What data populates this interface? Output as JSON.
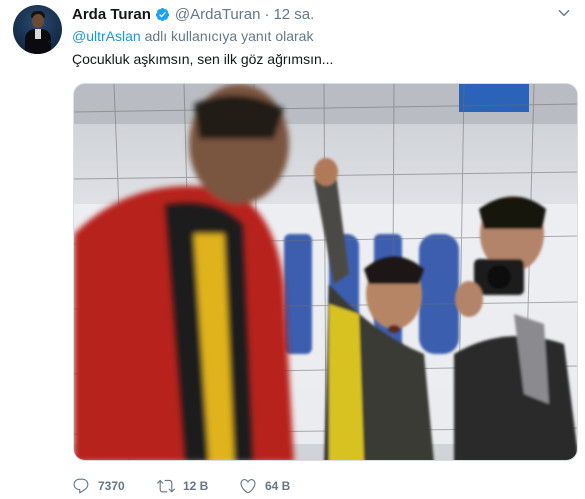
{
  "tweet": {
    "author_name": "Arda Turan",
    "handle": "@ArdaTuran",
    "separator": "·",
    "time": "12 sa.",
    "reply_mention": "@ultrAslan",
    "reply_suffix": "adlı kullanıcıya yanıt olarak",
    "text": "Çocukluk aşkımsın, sen ilk göz ağrımsın..."
  },
  "icons": {
    "verified": "verified-badge-icon",
    "more": "chevron-down-icon",
    "reply": "reply-icon",
    "retweet": "retweet-icon",
    "like": "heart-icon"
  },
  "stats": {
    "replies": "7370",
    "retweets": "12 B",
    "likes": "64 B"
  },
  "colors": {
    "link": "#1b95e0",
    "muted": "#657786",
    "text": "#14171a",
    "verified": "#1da1f2"
  }
}
